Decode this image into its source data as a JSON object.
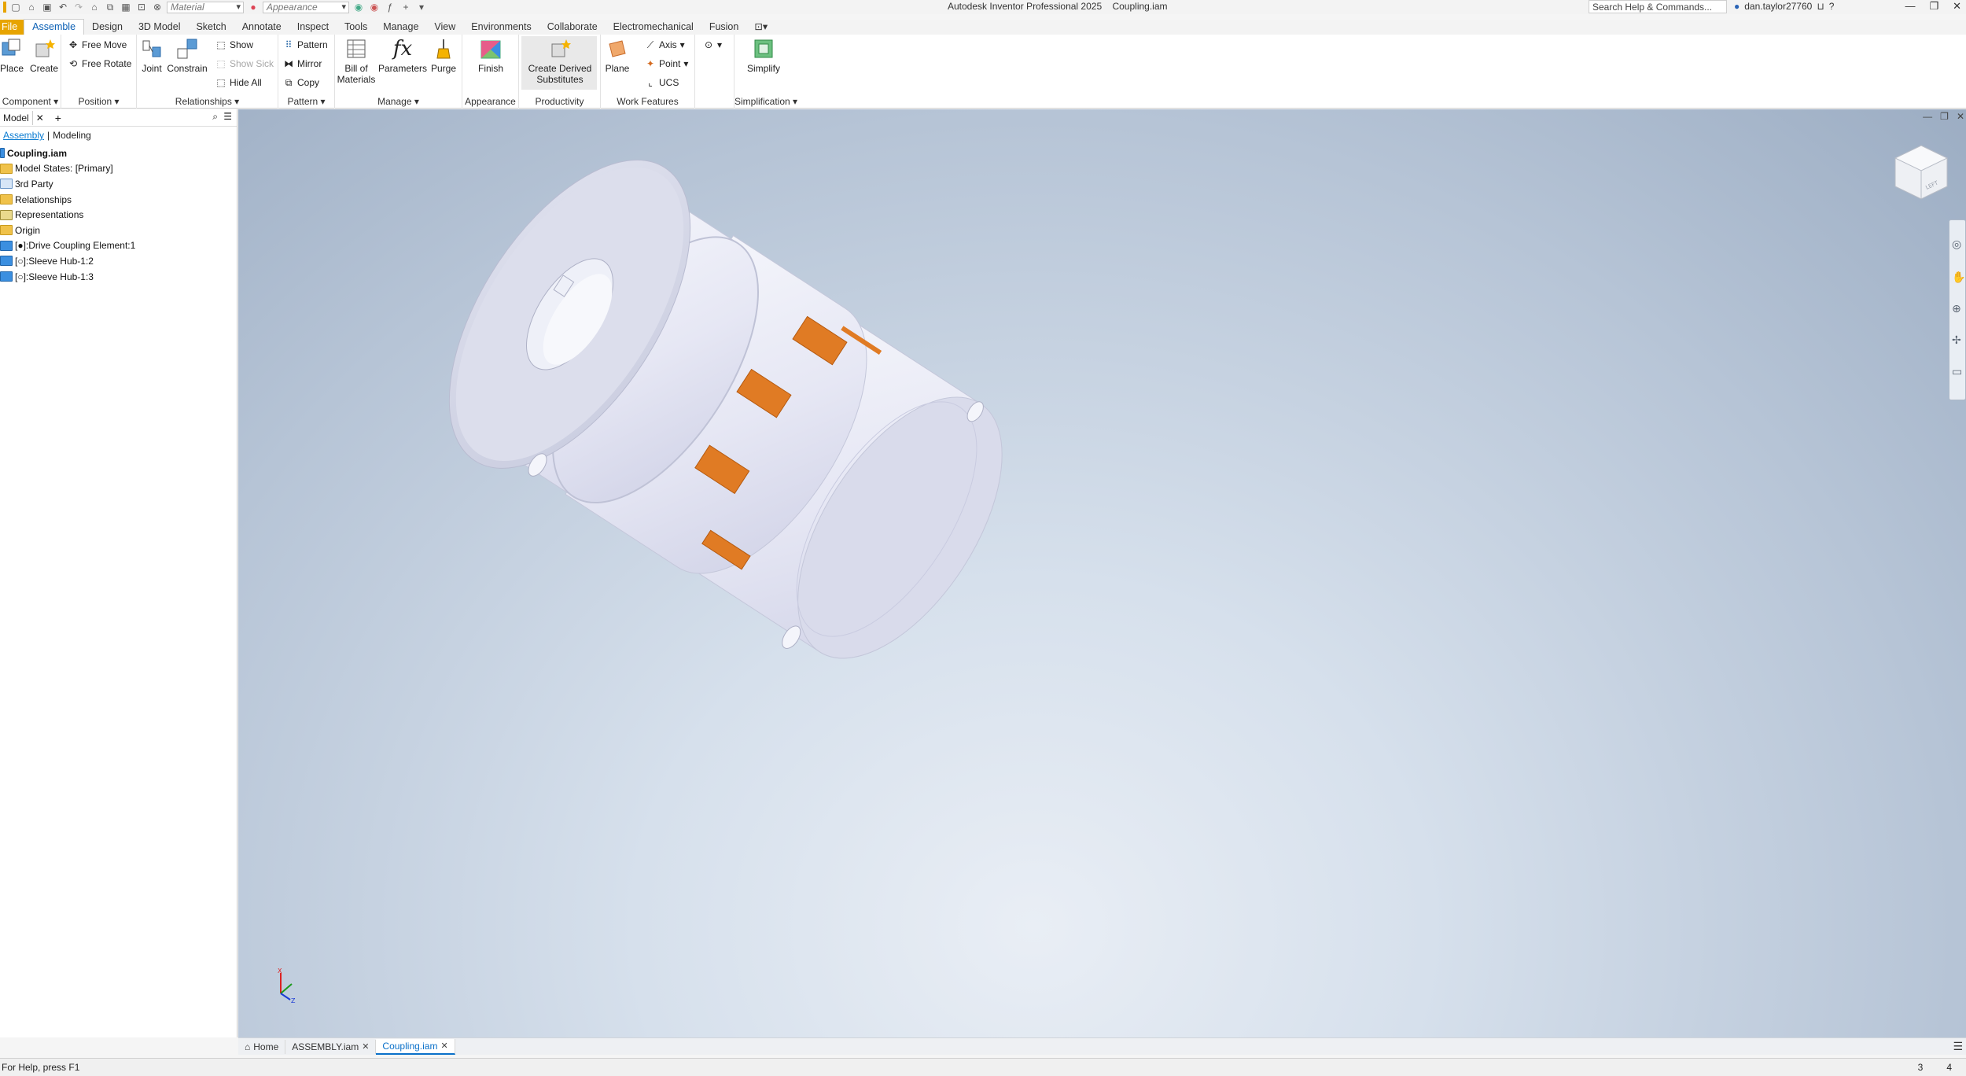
{
  "app": {
    "title": "Autodesk Inventor Professional 2025",
    "document": "Coupling.iam"
  },
  "quick_access": {
    "material_placeholder": "Material",
    "appearance_placeholder": "Appearance"
  },
  "search": {
    "placeholder": "Search Help & Commands..."
  },
  "user": {
    "name": "dan.taylor27760"
  },
  "ribbon_tabs": [
    "File",
    "Assemble",
    "Design",
    "3D Model",
    "Sketch",
    "Annotate",
    "Inspect",
    "Tools",
    "Manage",
    "View",
    "Environments",
    "Collaborate",
    "Electromechanical",
    "Fusion"
  ],
  "ribbon_active_tab": "Assemble",
  "ribbon": {
    "component": {
      "title": "Component",
      "place": "Place",
      "create": "Create"
    },
    "position": {
      "title": "Position",
      "free_move": "Free Move",
      "free_rotate": "Free Rotate"
    },
    "relationships": {
      "title": "Relationships",
      "joint": "Joint",
      "constrain": "Constrain",
      "show": "Show",
      "show_sick": "Show Sick",
      "hide_all": "Hide All"
    },
    "pattern": {
      "title": "Pattern",
      "pattern": "Pattern",
      "mirror": "Mirror",
      "copy": "Copy"
    },
    "manage": {
      "title": "Manage",
      "bom_line1": "Bill of",
      "bom_line2": "Materials",
      "parameters": "Parameters",
      "purge": "Purge"
    },
    "appearance": {
      "title": "Appearance",
      "finish": "Finish"
    },
    "productivity": {
      "title": "Productivity",
      "cds_line1": "Create Derived",
      "cds_line2": "Substitutes"
    },
    "work_features": {
      "title": "Work Features",
      "plane": "Plane",
      "axis": "Axis",
      "point": "Point",
      "ucs": "UCS"
    },
    "simplification": {
      "title": "Simplification",
      "simplify": "Simplify"
    }
  },
  "browser": {
    "tab": "Model",
    "sub_tabs": [
      "Assembly",
      "Modeling"
    ],
    "active_sub": "Assembly",
    "tree": [
      {
        "label": "Coupling.iam",
        "icon": "assembly-icon",
        "bold": true
      },
      {
        "label": "Model States: [Primary]",
        "icon": "folder-icon"
      },
      {
        "label": "3rd Party",
        "icon": "third-party-icon"
      },
      {
        "label": "Relationships",
        "icon": "folder-icon"
      },
      {
        "label": "Representations",
        "icon": "representations-icon"
      },
      {
        "label": "Origin",
        "icon": "folder-icon"
      },
      {
        "label": "[●]:Drive Coupling Element:1",
        "icon": "part-icon"
      },
      {
        "label": "[○]:Sleeve Hub-1:2",
        "icon": "part-icon"
      },
      {
        "label": "[○]:Sleeve Hub-1:3",
        "icon": "part-icon"
      }
    ]
  },
  "doc_tabs": [
    {
      "label": "Home",
      "icon": "home-icon"
    },
    {
      "label": "ASSEMBLY.iam"
    },
    {
      "label": "Coupling.iam",
      "active": true
    }
  ],
  "status": {
    "help_text": "For Help, press F1",
    "count_a": "3",
    "count_b": "4"
  },
  "colors": {
    "accent": "#0a5fb4",
    "file_tab": "#e7a400",
    "spider_element": "#e07b24",
    "hub_body": "#e6e8f5"
  }
}
